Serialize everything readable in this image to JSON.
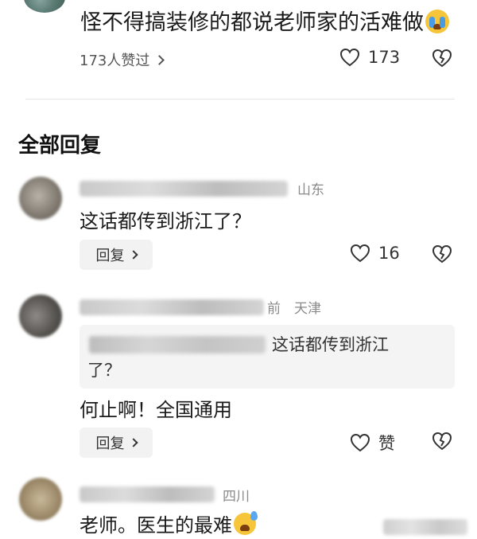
{
  "top_comment": {
    "text": "怪不得搞装修的都说老师家的活难做",
    "emoji": "crying-face-icon",
    "likes_link_label": "173人赞过",
    "like_count": "173"
  },
  "section_title": "全部回复",
  "replies": [
    {
      "location": "山东",
      "text": "这话都传到浙江了？",
      "reply_label": "回复",
      "like_count": "16"
    },
    {
      "time_fragment": "前",
      "location": "天津",
      "quote_text": "这话都传到浙江",
      "quote_text_2": "了？",
      "text": "何止啊！全国通用",
      "reply_label": "回复",
      "like_label": "赞"
    },
    {
      "location": "四川",
      "text": "老师。医生的最难",
      "emoji": "sweat-face-icon"
    }
  ],
  "colors": {
    "text": "#1a1a1a",
    "meta": "#8a8a8a",
    "button_bg": "#f2f2f2"
  }
}
